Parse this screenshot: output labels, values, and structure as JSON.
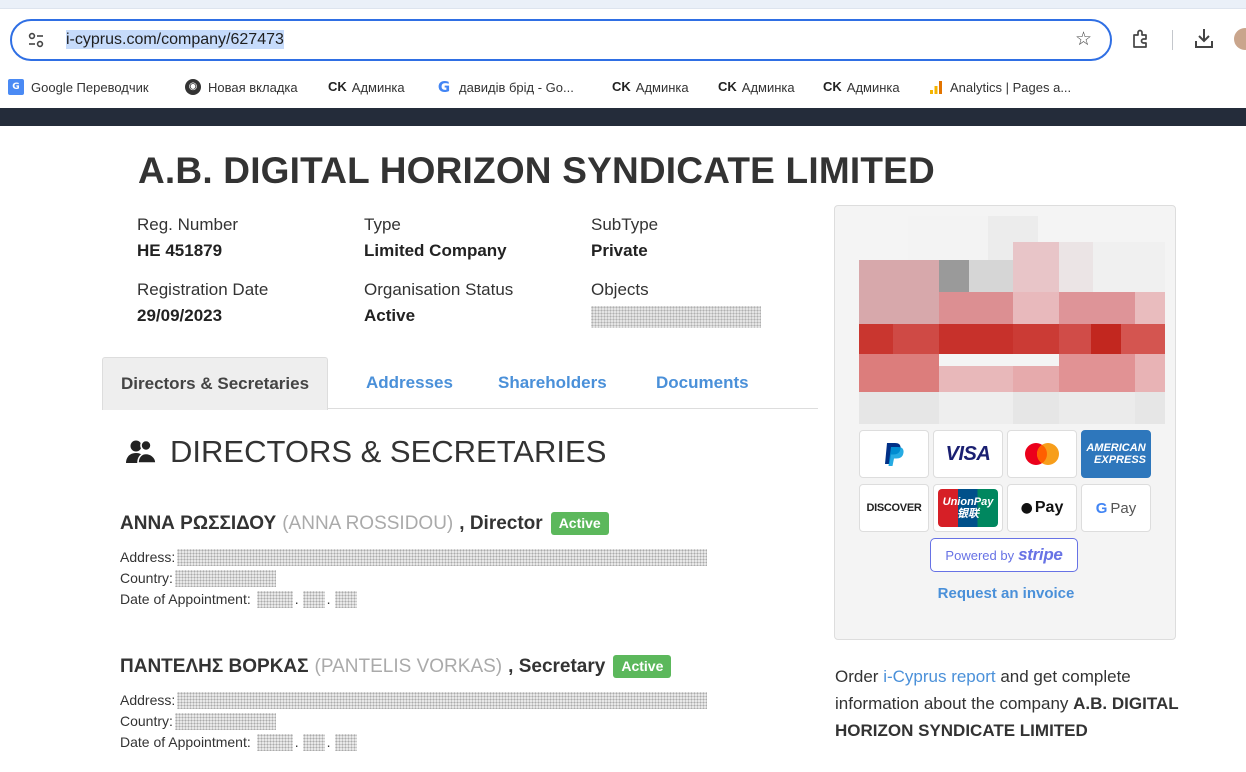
{
  "browser": {
    "url": "i-cyprus.com/company/627473",
    "bookmarks": [
      {
        "label": "Google Переводчик",
        "icon": "google-translate-icon"
      },
      {
        "label": "Новая вкладка",
        "icon": "new-tab-icon"
      },
      {
        "label": "Админка",
        "icon": "ck-icon"
      },
      {
        "label": "давидів брід - Go...",
        "icon": "google-icon"
      },
      {
        "label": "Админка",
        "icon": "ck-icon"
      },
      {
        "label": "Админка",
        "icon": "ck-icon"
      },
      {
        "label": "Админка",
        "icon": "ck-icon"
      },
      {
        "label": "Analytics | Pages a...",
        "icon": "analytics-icon"
      }
    ],
    "ck_mark": "CK"
  },
  "company": {
    "name": "A.B. DIGITAL HORIZON SYNDICATE LIMITED",
    "fields": [
      {
        "label": "Reg. Number",
        "value": "HE 451879"
      },
      {
        "label": "Type",
        "value": "Limited Company"
      },
      {
        "label": "SubType",
        "value": "Private"
      },
      {
        "label": "Registration Date",
        "value": "29/09/2023"
      },
      {
        "label": "Organisation Status",
        "value": "Active"
      },
      {
        "label": "Objects",
        "value": ""
      }
    ]
  },
  "tabs": [
    {
      "label": "Directors & Secretaries",
      "active": true
    },
    {
      "label": "Addresses",
      "active": false
    },
    {
      "label": "Shareholders",
      "active": false
    },
    {
      "label": "Documents",
      "active": false
    }
  ],
  "section": {
    "title": "DIRECTORS & SECRETARIES",
    "icon": "users-icon"
  },
  "people": [
    {
      "name": "ΑΝΝΑ ΡΩΣΣΙΔΟΥ",
      "latin": "(ANNA ROSSIDOU)",
      "role": ", Director",
      "status": "Active",
      "address_label": "Address:",
      "country_label": "Country:",
      "appointment_label": "Date of Appointment:"
    },
    {
      "name": "ΠΑΝΤΕΛΗΣ ΒΟΡΚΑΣ",
      "latin": "(PANTELIS VORKAS)",
      "role": ", Secretary",
      "status": "Active",
      "address_label": "Address:",
      "country_label": "Country:",
      "appointment_label": "Date of Appointment:"
    }
  ],
  "sidebar": {
    "payments": [
      "PayPal",
      "VISA",
      "Mastercard",
      "AMERICAN EXPRESS",
      "DISCOVER",
      "UnionPay",
      "Apple Pay",
      "G Pay"
    ],
    "payment_labels": {
      "visa": "VISA",
      "amex_1": "AMERICAN",
      "amex_2": "EXPRESS",
      "discover": "DISCOVER",
      "unionpay_1": "UnionPay",
      "unionpay_2": "银联",
      "applepay": "Pay",
      "gpay_g": "G",
      "gpay_pay": "Pay"
    },
    "powered_by": "Powered by",
    "stripe": "stripe",
    "invoice_link": "Request an invoice",
    "order_prefix": "Order ",
    "order_link": "i-Cyprus report",
    "order_middle": " and get complete information about the company ",
    "order_company": "A.B. DIGITAL HORIZON SYNDICATE LIMITED"
  },
  "colors": {
    "accent": "#4a90d9",
    "active_badge": "#5cb85c",
    "stripe": "#6772e5",
    "header_dark": "#242c3a"
  }
}
